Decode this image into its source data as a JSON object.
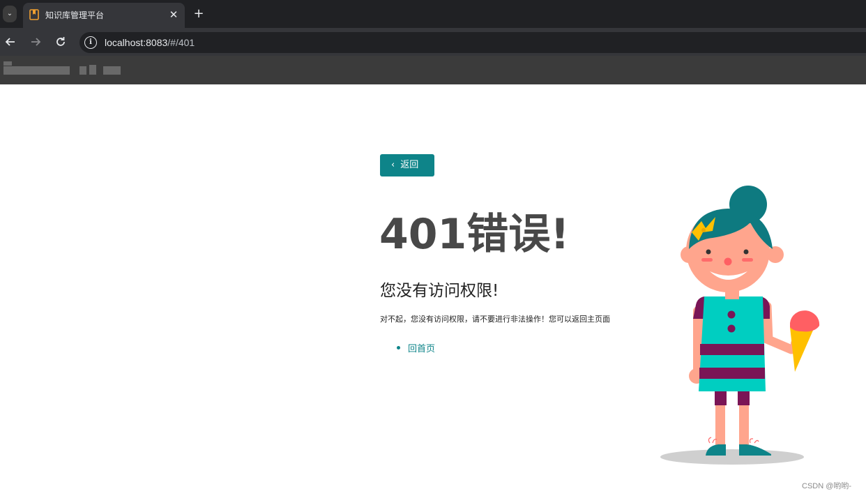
{
  "browser": {
    "tab": {
      "title": "知识库管理平台",
      "favicon": "bookmark-icon"
    },
    "new_tab_icon": "plus-icon",
    "close_icon": "close-icon",
    "address": {
      "host": "localhost:8083",
      "path": "/#/401"
    },
    "nav": {
      "back": "arrow-left-icon",
      "forward": "arrow-right-icon",
      "reload": "reload-icon"
    }
  },
  "page": {
    "back_button": "返回",
    "error_title": "401错误!",
    "error_subtitle": "您没有访问权限!",
    "error_description": "对不起，您没有访问权限，请不要进行非法操作！您可以返回主页面",
    "links": [
      {
        "label": "回首页"
      }
    ],
    "illustration": "girl-with-ice-cream"
  },
  "watermark": "CSDN @哟哟-",
  "colors": {
    "accent": "#0e8489",
    "title": "#484848",
    "tab_bar": "#202124",
    "toolbar": "#35363a"
  }
}
